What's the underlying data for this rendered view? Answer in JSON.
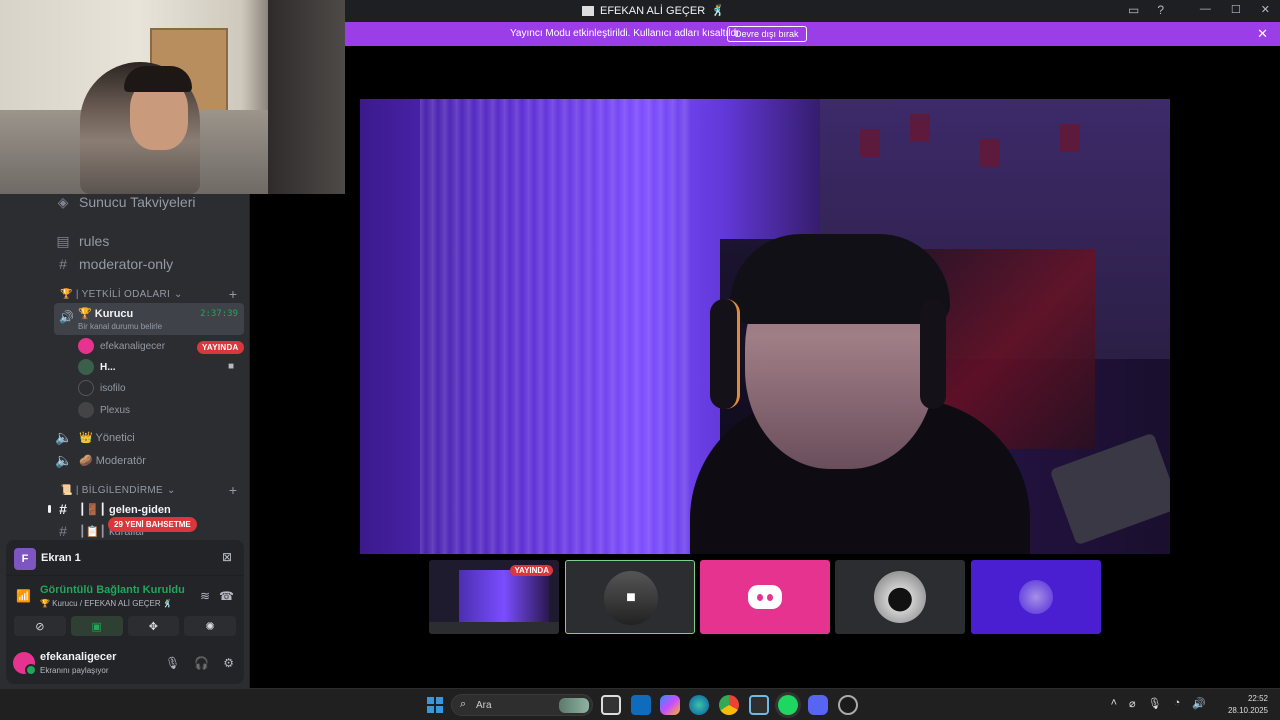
{
  "window": {
    "title": "EFEKAN ALİ GEÇER",
    "title_emoji": "🕺"
  },
  "notice": {
    "message": "Yayıncı Modu etkinleştirildi. Kullanıcı adları kısaltıldı.",
    "button": "Devre dışı bırak"
  },
  "sidebar": {
    "items": [
      {
        "label": "Sunucu Takviyeleri",
        "icon": "boost-icon"
      },
      {
        "label": "rules",
        "icon": "rules-icon"
      },
      {
        "label": "moderator-only",
        "icon": "hash-icon"
      }
    ],
    "category_authority": "🏆 | YETKİLİ ODALARI",
    "voice_channel": {
      "name": "🏆 Kurucu",
      "status": "Bir kanal durumu belirle",
      "timer": "2:37:39"
    },
    "voice_users": [
      {
        "name": "efekanaligecer",
        "badge": "YAYINDA"
      },
      {
        "name": "H..."
      },
      {
        "name": "isofilo"
      },
      {
        "name": "Plexus"
      }
    ],
    "voice_channels_more": [
      {
        "label": "👑 Yönetici"
      },
      {
        "label": "🥔 Moderatör"
      }
    ],
    "category_info": "📜 | BİLGİLENDİRME",
    "text_channels": [
      {
        "label": "┃🚪┃ gelen-giden"
      },
      {
        "label": "┃📋┃ kurallar"
      }
    ],
    "new_badge": "29 YENİ BAHSETME"
  },
  "panel": {
    "screen_title": "Ekran 1",
    "screen_logo_letter": "F",
    "connection_title": "Görüntülü Bağlantı Kuruldu",
    "connection_sub": "🏆 Kurucu / EFEKAN ALİ GEÇER 🕺",
    "username": "efekanaligecer",
    "user_status": "Ekranını paylaşıyor"
  },
  "stage": {
    "thumb_live_badge": "YAYINDA"
  },
  "taskbar": {
    "search_placeholder": "Ara",
    "time": "22:52",
    "date": "28.10.2025"
  },
  "colors": {
    "accent_purple": "#9b3ee8",
    "live_red": "#da373c",
    "connected_green": "#23a55a",
    "discord_pink": "#e6338f"
  }
}
